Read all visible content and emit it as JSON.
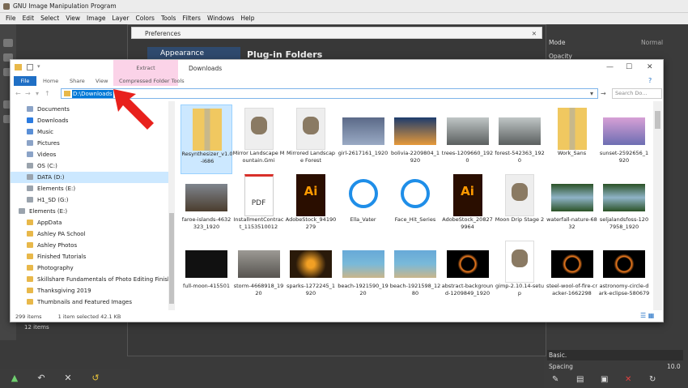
{
  "gimp": {
    "title": "GNU Image Manipulation Program",
    "menu": [
      "File",
      "Edit",
      "Select",
      "View",
      "Image",
      "Layer",
      "Colors",
      "Tools",
      "Filters",
      "Windows",
      "Help"
    ],
    "right_panel": {
      "mode_label": "Mode",
      "mode_value": "Normal",
      "opacity_label": "Opacity",
      "brush_preset": "Basic.",
      "spacing_label": "Spacing",
      "spacing_value": "10.0"
    },
    "left_status": "12 items"
  },
  "preferences": {
    "title": "Preferences",
    "sidebar_selected": "Appearance",
    "heading": "Plug-in Folders"
  },
  "explorer": {
    "title": "Downloads",
    "extract_tab": "Extract",
    "tabs": [
      "File",
      "Home",
      "Share",
      "View",
      "Compressed Folder Tools"
    ],
    "address": "D:\\Downloads",
    "search_placeholder": "Search Do...",
    "nav_items": [
      {
        "label": "Documents",
        "color": "#8ba3c7",
        "indent": 1
      },
      {
        "label": "Downloads",
        "color": "#2b7be0",
        "indent": 1
      },
      {
        "label": "Music",
        "color": "#5a8fd6",
        "indent": 1
      },
      {
        "label": "Pictures",
        "color": "#8ba3c7",
        "indent": 1
      },
      {
        "label": "Videos",
        "color": "#8ba3c7",
        "indent": 1
      },
      {
        "label": "OS (C:)",
        "color": "#9aa3ad",
        "indent": 1
      },
      {
        "label": "DATA (D:)",
        "color": "#9aa3ad",
        "indent": 1,
        "selected": true
      },
      {
        "label": "Elements (E:)",
        "color": "#9aa3ad",
        "indent": 1
      },
      {
        "label": "H1_SD (G:)",
        "color": "#9aa3ad",
        "indent": 1
      },
      {
        "label": "Elements (E:)",
        "color": "#9aa3ad",
        "indent": 0
      },
      {
        "label": "AppData",
        "color": "#e8b84a",
        "indent": 1
      },
      {
        "label": "Ashley PA School",
        "color": "#e8b84a",
        "indent": 1
      },
      {
        "label": "Ashley Photos",
        "color": "#e8b84a",
        "indent": 1
      },
      {
        "label": "Finished Tutorials",
        "color": "#e8b84a",
        "indent": 1
      },
      {
        "label": "Photography",
        "color": "#e8b84a",
        "indent": 1
      },
      {
        "label": "Skillshare Fundamentals of Photo Editing Finished Les",
        "color": "#e8b84a",
        "indent": 1
      },
      {
        "label": "Thanksgiving 2019",
        "color": "#e8b84a",
        "indent": 1
      },
      {
        "label": "Thumbnails and Featured Images",
        "color": "#e8b84a",
        "indent": 1
      }
    ],
    "files": [
      {
        "name": "Resynthesizer_v1.0-i686",
        "kind": "zip",
        "selected": true
      },
      {
        "name": "Mirror Landscape Mountain.Gmi",
        "kind": "gimp"
      },
      {
        "name": "Mirrored Landscape Forest",
        "kind": "gimp"
      },
      {
        "name": "girl-2617161_1920",
        "kind": "sky"
      },
      {
        "name": "bolivia-2209804_1920",
        "kind": "sunset"
      },
      {
        "name": "trees-1209660_1920",
        "kind": "fog"
      },
      {
        "name": "forest-542363_1920",
        "kind": "fog"
      },
      {
        "name": "Work_Sans",
        "kind": "zip"
      },
      {
        "name": "sunset-2592656_1920",
        "kind": "lila"
      },
      {
        "name": "faroe-islands-4632323_1920",
        "kind": "cliff"
      },
      {
        "name": "InstallmentContract_1153510012",
        "kind": "pdf"
      },
      {
        "name": "AdobeStock_94190279",
        "kind": "ai"
      },
      {
        "name": "Ella_Vater",
        "kind": "disc"
      },
      {
        "name": "Face_Hit_Series",
        "kind": "disc"
      },
      {
        "name": "AdobeStock_208279964",
        "kind": "ai"
      },
      {
        "name": "Moon Drip Stage 2",
        "kind": "gimp"
      },
      {
        "name": "waterfall-nature-6832",
        "kind": "fall"
      },
      {
        "name": "seljalandsfoss-1207958_1920",
        "kind": "fall"
      },
      {
        "name": "full-moon-415501",
        "kind": "moon"
      },
      {
        "name": "storm-4668918_1920",
        "kind": "storm"
      },
      {
        "name": "sparks-1272245_1920",
        "kind": "sparks"
      },
      {
        "name": "beach-1921590_1920",
        "kind": "beach"
      },
      {
        "name": "beach-1921598_1280",
        "kind": "beach"
      },
      {
        "name": "abstract-background-1209849_1920",
        "kind": "eclipse"
      },
      {
        "name": "gimp-2.10.14-setup",
        "kind": "setup"
      },
      {
        "name": "steel-wool-of-fire-cracker-1662298",
        "kind": "eclipse"
      },
      {
        "name": "astronomy-circle-dark-eclipse-580679",
        "kind": "eclipse"
      }
    ],
    "pdf_label": "PDF",
    "ai_label": "Ai",
    "status": {
      "count": "299 items",
      "selection": "1 item selected  42.1 KB"
    }
  },
  "colors": {
    "accent": "#1f6fc5",
    "arrow": "#e8211c",
    "selection": "#cce8ff"
  }
}
